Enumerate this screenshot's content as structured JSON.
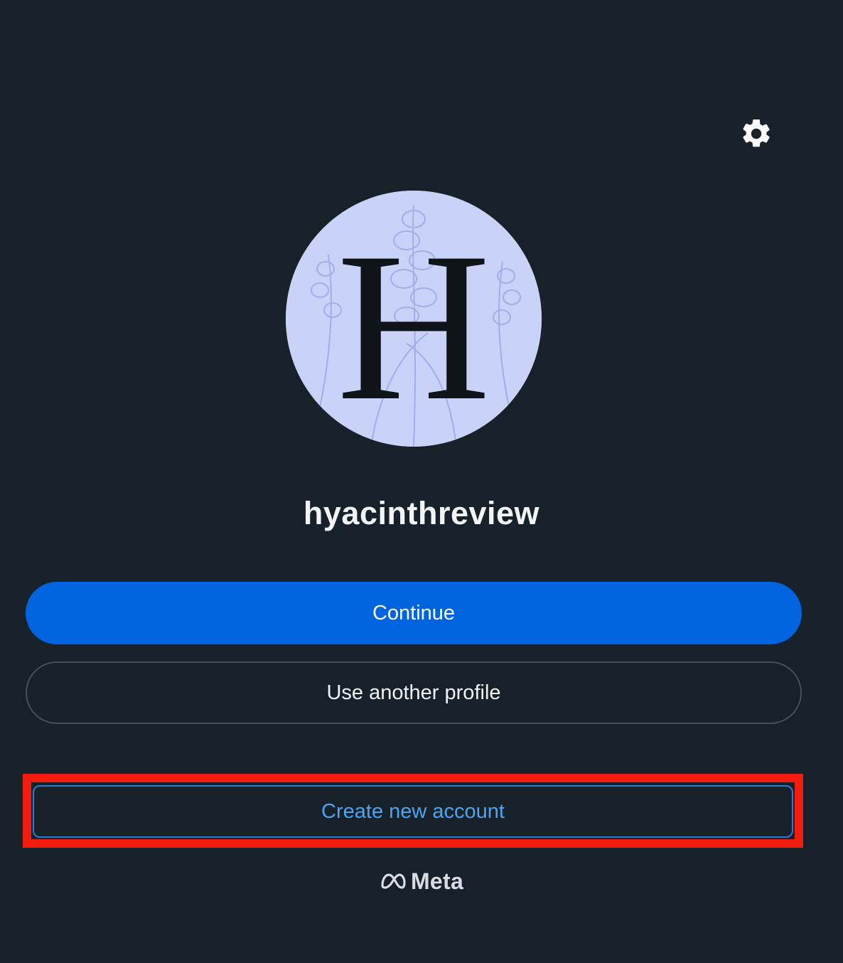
{
  "profile": {
    "username": "hyacinthreview",
    "avatar_letter": "H"
  },
  "actions": {
    "continue_label": "Continue",
    "another_profile_label": "Use another profile",
    "create_account_label": "Create new account"
  },
  "footer": {
    "brand": "Meta"
  },
  "icons": {
    "settings": "gear-icon",
    "brand": "meta-infinity-icon"
  },
  "colors": {
    "background": "#17212a",
    "primary": "#0064e0",
    "link": "#4ea3f1",
    "highlight": "#f21b0d"
  }
}
